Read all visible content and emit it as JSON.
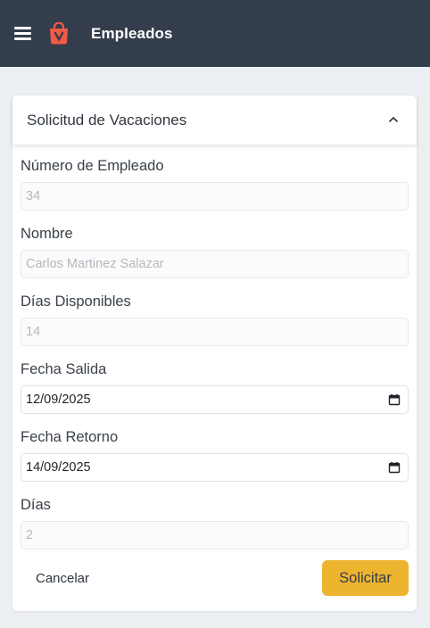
{
  "header": {
    "title": "Empleados",
    "background": "#343d4c",
    "logo_color": "#f15a45",
    "menu_icon": "hamburger-menu-icon",
    "logo_icon": "shopping-bag-logo-icon"
  },
  "form": {
    "title": "Solicitud de Vacaciones",
    "collapse_icon": "chevron-up-icon",
    "fields": {
      "employee_number": {
        "label": "Número de Empleado",
        "value": "34"
      },
      "name": {
        "label": "Nombre",
        "value": "Carlos Martinez Salazar"
      },
      "available_days": {
        "label": "Días Disponibles",
        "value": "14"
      },
      "departure_date": {
        "label": "Fecha Salida",
        "value": "12/09/2025"
      },
      "return_date": {
        "label": "Fecha Retorno",
        "value": "14/09/2025"
      },
      "days": {
        "label": "Días",
        "value": "2"
      }
    },
    "cancel_label": "Cancelar",
    "submit_label": "Solicitar",
    "accent_color": "#ecb42f"
  }
}
